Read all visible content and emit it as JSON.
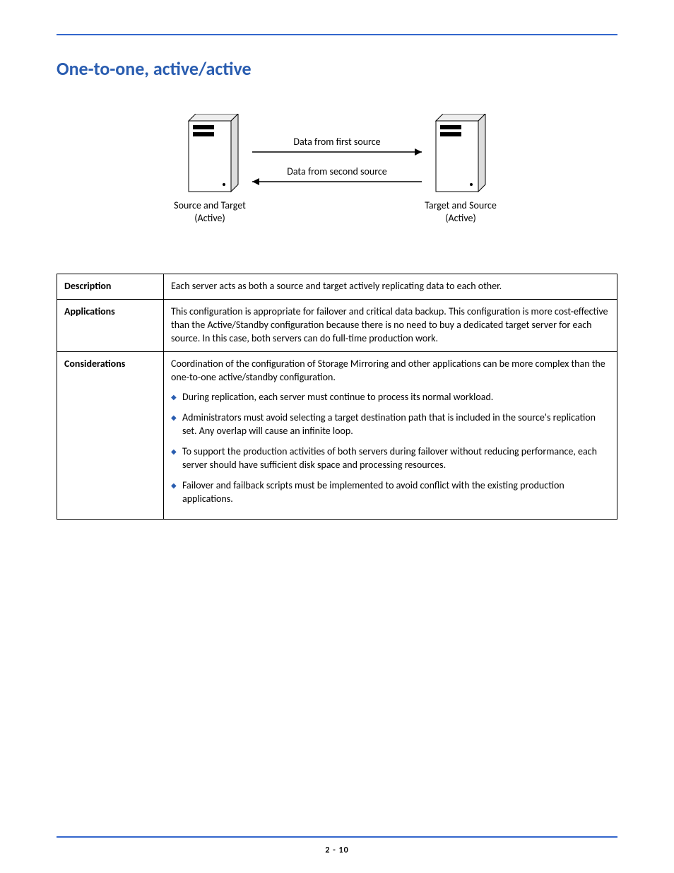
{
  "heading": "One-to-one, active/active",
  "diagram": {
    "arrow1_label": "Data from first source",
    "arrow2_label": "Data from second source",
    "left_caption_line1": "Source and Target",
    "left_caption_line2": "(Active)",
    "right_caption_line1": "Target and Source",
    "right_caption_line2": "(Active)"
  },
  "table": {
    "row1_label": "Description",
    "row1_text": "Each server acts as both a source and target actively replicating data to each other.",
    "row2_label": "Applications",
    "row2_text": "This configuration is appropriate for failover and critical data backup. This configuration is more cost-effective than the Active/Standby configuration because there is no need to buy a dedicated target server for each source.  In this case, both servers can do full-time production work.",
    "row3_label": "Considerations",
    "row3_intro": "Coordination of the configuration of Storage Mirroring and other applications can be more complex than the one-to-one active/standby configuration.",
    "row3_bullets": {
      "b0": "During replication, each server must continue to process its normal workload.",
      "b1": "Administrators must avoid selecting a target destination path that is included in the source's replication set. Any overlap will cause an infinite loop.",
      "b2": "To support the production activities of both servers during failover without reducing performance, each server should have sufficient disk space and processing resources.",
      "b3": "Failover and failback scripts must be implemented to avoid conflict with the existing production applications."
    }
  },
  "footer": {
    "page_number": "2 - 10"
  }
}
